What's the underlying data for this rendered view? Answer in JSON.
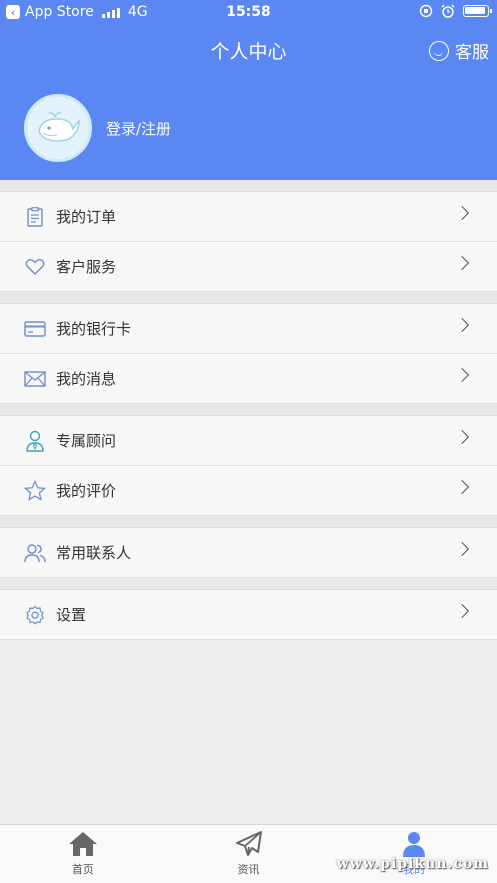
{
  "status_bar": {
    "carrier": "App Store",
    "network": "4G",
    "time": "15:58"
  },
  "header": {
    "title": "个人中心",
    "service_label": "客服",
    "login_label": "登录/注册"
  },
  "menu_groups": [
    [
      {
        "label": "我的订单",
        "icon": "order-icon"
      },
      {
        "label": "客户服务",
        "icon": "heart-icon"
      }
    ],
    [
      {
        "label": "我的银行卡",
        "icon": "bank-card-icon"
      },
      {
        "label": "我的消息",
        "icon": "envelope-icon"
      }
    ],
    [
      {
        "label": "专属顾问",
        "icon": "advisor-icon"
      },
      {
        "label": "我的评价",
        "icon": "star-icon"
      }
    ],
    [
      {
        "label": "常用联系人",
        "icon": "contacts-icon"
      }
    ],
    [
      {
        "label": "设置",
        "icon": "gear-icon"
      }
    ]
  ],
  "tab_bar": [
    {
      "label": "首页",
      "icon": "home-icon",
      "active": false
    },
    {
      "label": "资讯",
      "icon": "paper-plane-icon",
      "active": false
    },
    {
      "label": "我的",
      "icon": "user-icon",
      "active": true
    }
  ],
  "watermark": "www.pipikun.com",
  "colors": {
    "primary": "#5b87f2",
    "background": "#efeff1",
    "icon_stroke": "#6f8fc8"
  }
}
